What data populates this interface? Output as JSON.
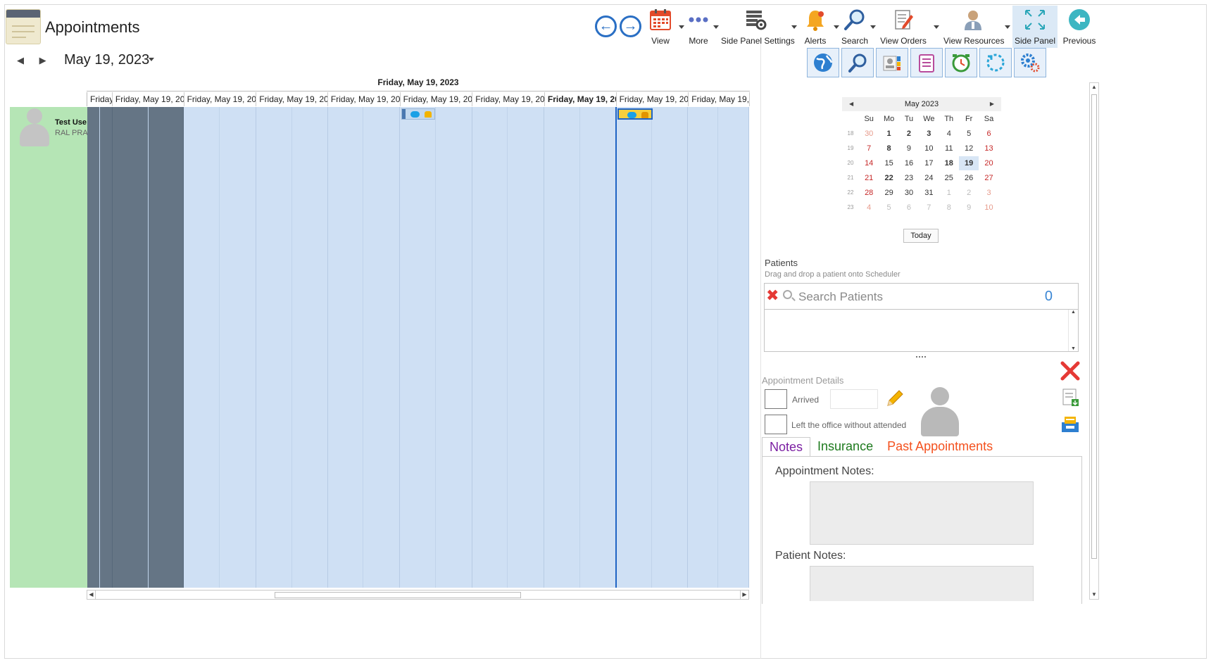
{
  "app": {
    "title": "Appointments"
  },
  "toolbar": {
    "view_label": "View",
    "more_label": "More",
    "side_panel_settings_label": "Side Panel Settings",
    "alerts_label": "Alerts",
    "search_label": "Search",
    "view_orders_label": "View Orders",
    "view_resources_label": "View Resources",
    "side_panel_label": "Side Panel",
    "previous_label": "Previous"
  },
  "scheduler": {
    "current_date": "May 19, 2023",
    "day_header": "Friday, May 19, 2023",
    "columns": [
      "Friday",
      "Friday, May 19, 202",
      "Friday, May 19, 202",
      "Friday, May 19, 202",
      "Friday, May 19, 202",
      "Friday, May 19, 202",
      "Friday, May 19, 202",
      "Friday, May 19, 20",
      "Friday, May 19, 202",
      "Friday, May 19,"
    ],
    "resource": {
      "name": "Test Use",
      "subtitle": "RAL PRA"
    }
  },
  "mini_calendar": {
    "month_label": "May 2023",
    "weekday_headers": [
      "Su",
      "Mo",
      "Tu",
      "We",
      "Th",
      "Fr",
      "Sa"
    ],
    "weeks": [
      {
        "num": "18",
        "days": [
          "30",
          "1",
          "2",
          "3",
          "4",
          "5",
          "6"
        ]
      },
      {
        "num": "19",
        "days": [
          "7",
          "8",
          "9",
          "10",
          "11",
          "12",
          "13"
        ]
      },
      {
        "num": "20",
        "days": [
          "14",
          "15",
          "16",
          "17",
          "18",
          "19",
          "20"
        ]
      },
      {
        "num": "21",
        "days": [
          "21",
          "22",
          "23",
          "24",
          "25",
          "26",
          "27"
        ]
      },
      {
        "num": "22",
        "days": [
          "28",
          "29",
          "30",
          "31",
          "1",
          "2",
          "3"
        ]
      },
      {
        "num": "23",
        "days": [
          "4",
          "5",
          "6",
          "7",
          "8",
          "9",
          "10"
        ]
      }
    ],
    "today_label": "Today"
  },
  "patients": {
    "title": "Patients",
    "hint": "Drag and drop a patient onto Scheduler",
    "search_placeholder": "Search Patients",
    "count": "0"
  },
  "appointment_details": {
    "title": "Appointment Details",
    "arrived_label": "Arrived",
    "left_label": "Left the office without attended"
  },
  "tabs": {
    "notes": "Notes",
    "insurance": "Insurance",
    "past_appointments": "Past Appointments"
  },
  "notes": {
    "appointment_notes_label": "Appointment Notes:",
    "patient_notes_label": "Patient Notes:"
  },
  "colors": {
    "accent": "#2a6fc4",
    "resource_bg": "#b5e5b5",
    "grid_bg": "#cfe0f4",
    "dark_cells": "#657585",
    "now_line": "#1f64c4"
  }
}
